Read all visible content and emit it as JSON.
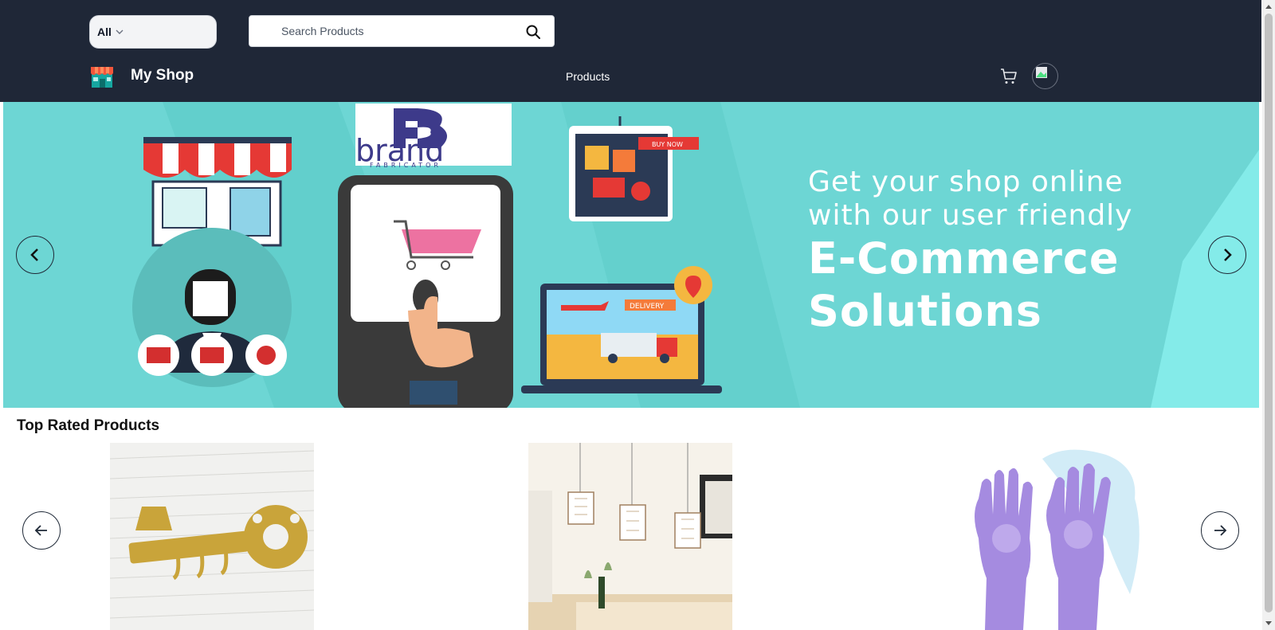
{
  "header": {
    "category_select": {
      "value": "All",
      "icon": "chevron-down-icon"
    },
    "search": {
      "placeholder": "Search Products",
      "icon": "search-icon"
    },
    "brand": {
      "name": "My Shop",
      "logo_icon": "storefront-icon"
    },
    "nav": {
      "products_label": "Products"
    },
    "cart_icon": "cart-icon",
    "avatar_icon": "user-avatar"
  },
  "hero": {
    "logo_text": "brand",
    "logo_subtext": "FABRICATOR",
    "tag_text": "BUY NOW",
    "delivery_text": "DELIVERY",
    "line1": "Get your shop online",
    "line2": "with our user friendly",
    "line3": "E-Commerce",
    "line4": "Solutions",
    "prev_icon": "chevron-left-icon",
    "next_icon": "chevron-right-icon",
    "background_color": "#6dd6d4"
  },
  "top_rated": {
    "title": "Top Rated Products",
    "products": [
      {
        "image": "brass-key-hook-image"
      },
      {
        "image": "crystal-pendant-lights-image"
      },
      {
        "image": "purple-silicone-gloves-image"
      }
    ],
    "prev_icon": "arrow-left-icon",
    "next_icon": "arrow-right-icon"
  },
  "colors": {
    "header_bg": "#1f2737",
    "hero_bg": "#6dd6d4",
    "text_dark": "#111111"
  }
}
